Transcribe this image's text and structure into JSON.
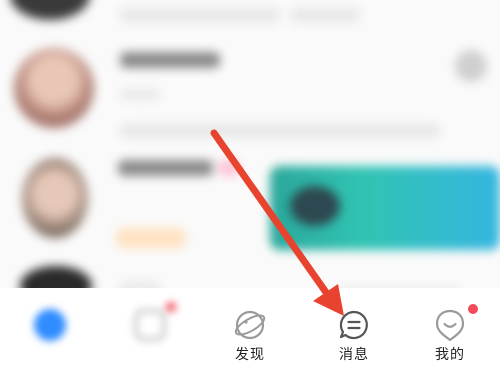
{
  "colors": {
    "accent_blue": "#2f8cff",
    "badge_red": "#f24a5a",
    "arrow_red": "#e8432e",
    "icon_gray": "#9a9a9a"
  },
  "tabbar": {
    "tabs": [
      {
        "label": "",
        "icon": "home-icon"
      },
      {
        "label": "",
        "icon": "video-icon"
      },
      {
        "label": "发现",
        "icon": "planet-icon"
      },
      {
        "label": "消息",
        "icon": "message-icon"
      },
      {
        "label": "我的",
        "icon": "profile-icon"
      }
    ]
  }
}
